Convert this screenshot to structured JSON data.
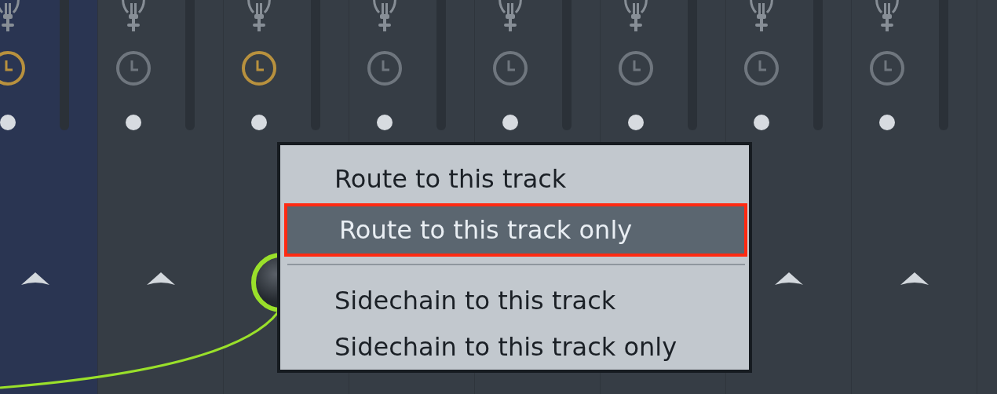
{
  "strips": [
    {
      "selected": true,
      "clock_on": true,
      "send_arrow": true
    },
    {
      "selected": false,
      "clock_on": false,
      "send_arrow": true
    },
    {
      "selected": false,
      "clock_on": true,
      "send_arrow": false,
      "send_knob": true
    },
    {
      "selected": false,
      "clock_on": false
    },
    {
      "selected": false,
      "clock_on": false
    },
    {
      "selected": false,
      "clock_on": false
    },
    {
      "selected": false,
      "clock_on": false,
      "send_arrow": true
    },
    {
      "selected": false,
      "clock_on": false,
      "send_arrow": true
    }
  ],
  "context_menu": {
    "items": [
      {
        "kind": "item",
        "label": "Route to this track",
        "selected": false
      },
      {
        "kind": "item",
        "label": "Route to this track only",
        "selected": true
      },
      {
        "kind": "separator"
      },
      {
        "kind": "item",
        "label": "Sidechain to this track",
        "selected": false
      },
      {
        "kind": "item",
        "label": "Sidechain to this track only",
        "selected": false
      }
    ]
  }
}
